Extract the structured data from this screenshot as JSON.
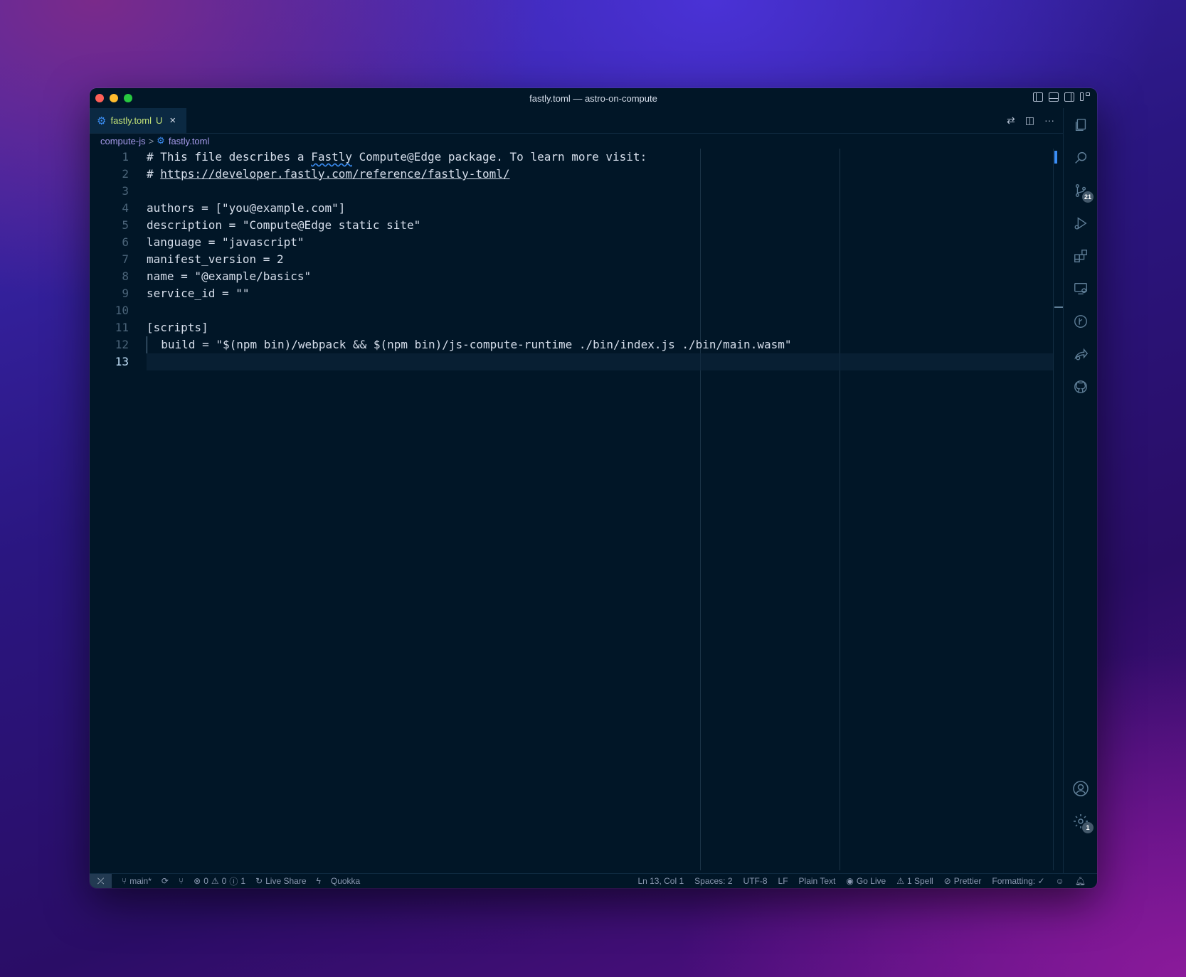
{
  "window": {
    "title": "fastly.toml — astro-on-compute"
  },
  "tab": {
    "name": "fastly.toml",
    "status": "U",
    "close": "×",
    "icon": "gear-icon"
  },
  "tab_actions": {
    "compare": "⇄",
    "split": "◫",
    "more": "···"
  },
  "breadcrumb": {
    "folder": "compute-js",
    "separator": ">",
    "file": "fastly.toml"
  },
  "editor": {
    "line_numbers": [
      "1",
      "2",
      "3",
      "4",
      "5",
      "6",
      "7",
      "8",
      "9",
      "10",
      "11",
      "12",
      "13"
    ],
    "active_line": 13,
    "lines": {
      "l1_pre": "# This file describes a ",
      "l1_word": "Fastly",
      "l1_post": " Compute@Edge package. To learn more visit:",
      "l2_hash": "# ",
      "l2_url": "https://developer.fastly.com/reference/fastly-toml/",
      "l4": "authors = [\"you@example.com\"]",
      "l5": "description = \"Compute@Edge static site\"",
      "l6": "language = \"javascript\"",
      "l7": "manifest_version = 2",
      "l8": "name = \"@example/basics\"",
      "l9": "service_id = \"\"",
      "l11": "[scripts]",
      "l12": "  build = \"$(npm bin)/webpack && $(npm bin)/js-compute-runtime ./bin/index.js ./bin/main.wasm\""
    }
  },
  "activity_bar": {
    "items": [
      {
        "icon": "files-icon"
      },
      {
        "icon": "search-icon"
      },
      {
        "icon": "source-control-icon",
        "badge": "21"
      },
      {
        "icon": "run-debug-icon"
      },
      {
        "icon": "extensions-icon"
      },
      {
        "icon": "remote-explorer-icon"
      },
      {
        "icon": "timeline-icon"
      },
      {
        "icon": "live-share-icon"
      },
      {
        "icon": "github-icon"
      }
    ],
    "accounts_icon": "account-icon",
    "settings_badge": "1"
  },
  "status_bar": {
    "branch": "main*",
    "errors": "0",
    "warnings": "0",
    "info": "1",
    "live_share": "Live Share",
    "quokka": "Quokka",
    "cursor": "Ln 13, Col 1",
    "spaces": "Spaces: 2",
    "encoding": "UTF-8",
    "eol": "LF",
    "language": "Plain Text",
    "go_live": "Go Live",
    "spell": "1 Spell",
    "prettier": "Prettier",
    "formatting": "Formatting: ✓"
  },
  "colors": {
    "editor_bg": "#011627",
    "tab_modified": "#c5e478",
    "accent": "#3b8ef5",
    "breadcrumb": "#a599e9"
  }
}
